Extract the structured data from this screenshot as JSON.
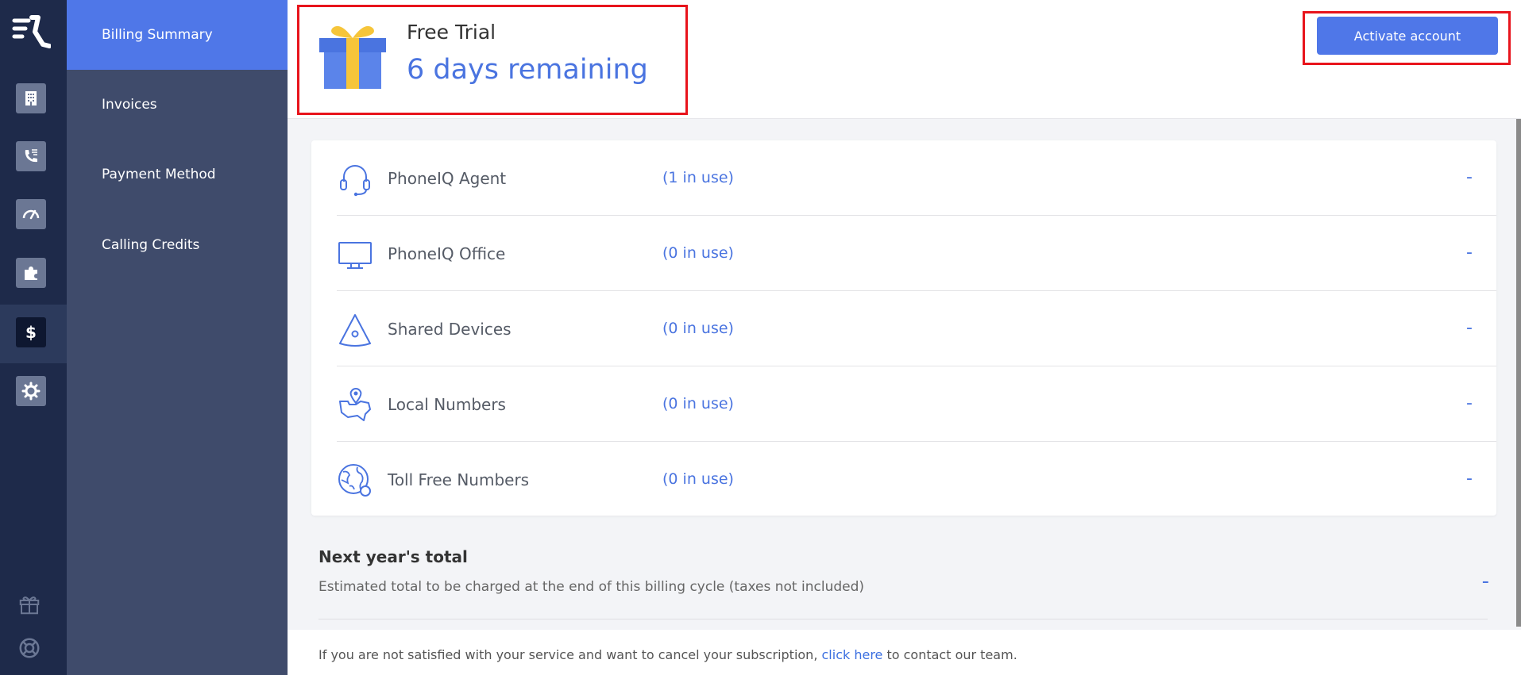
{
  "nav": {
    "items": [
      {
        "label": "Billing Summary",
        "active": true
      },
      {
        "label": "Invoices"
      },
      {
        "label": "Payment Method"
      },
      {
        "label": "Calling Credits"
      }
    ]
  },
  "rail_icons": [
    "building-icon",
    "phone-list-icon",
    "speedometer-icon",
    "puzzle-icon",
    "dollar-icon",
    "gear-icon",
    "gift-icon",
    "lifebuoy-icon"
  ],
  "trial": {
    "title": "Free Trial",
    "days": "6 days remaining"
  },
  "activate_label": "Activate account",
  "products": [
    {
      "name": "PhoneIQ Agent",
      "usage": "(1 in use)",
      "value": "-",
      "icon": "headset-icon"
    },
    {
      "name": "PhoneIQ Office",
      "usage": "(0 in use)",
      "value": "-",
      "icon": "monitor-icon"
    },
    {
      "name": "Shared Devices",
      "usage": "(0 in use)",
      "value": "-",
      "icon": "conference-phone-icon"
    },
    {
      "name": "Local Numbers",
      "usage": "(0 in use)",
      "value": "-",
      "icon": "map-pin-icon"
    },
    {
      "name": "Toll Free Numbers",
      "usage": "(0 in use)",
      "value": "-",
      "icon": "globe-icon"
    }
  ],
  "total": {
    "title": "Next year's total",
    "description": "Estimated total to be charged at the end of this billing cycle (taxes not included)",
    "value": "-"
  },
  "footer": {
    "before": "If you are not satisfied with your service and want to cancel your subscription, ",
    "link": "click here",
    "after": " to contact our team."
  },
  "colors": {
    "accent": "#4f77e8",
    "rail": "#1e2a4a",
    "subnav": "#3f4b6b",
    "highlight_border": "#e8141c"
  }
}
